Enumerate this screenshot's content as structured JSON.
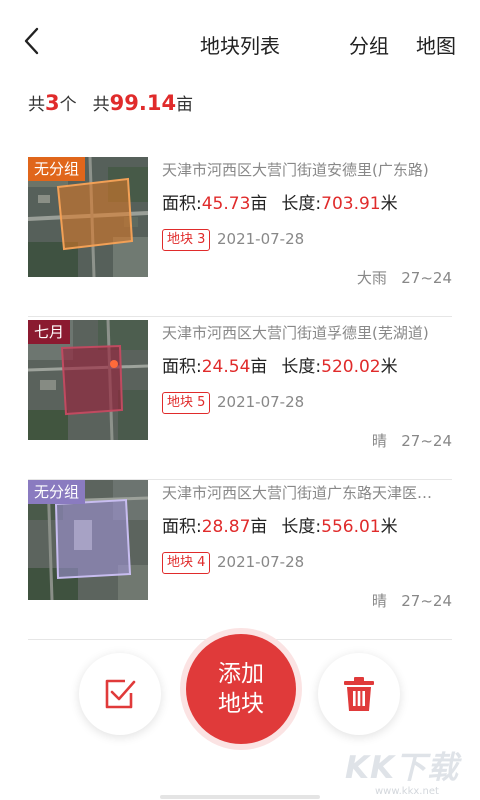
{
  "header": {
    "title": "地块列表",
    "group_label": "分组",
    "map_label": "地图"
  },
  "summary": {
    "prefix1": "共",
    "count": "3",
    "count_unit": "个",
    "prefix2": "共",
    "total_area": "99.14",
    "area_unit": "亩"
  },
  "labels": {
    "area": "面积:",
    "area_unit": "亩",
    "length": "长度:",
    "length_unit": "米"
  },
  "plots": [
    {
      "group_tag": "无分组",
      "tag_color": "#e0661b",
      "address": "天津市河西区大营门街道安德里(广东路)",
      "area": "45.73",
      "length": "703.91",
      "plot_label": "地块 3",
      "date": "2021-07-28",
      "weather": "大雨",
      "temp": "27~24",
      "overlay_color": "#e37a24"
    },
    {
      "group_tag": "七月",
      "tag_color": "#8b1a30",
      "address": "天津市河西区大营门街道孚德里(芜湖道)",
      "area": "24.54",
      "length": "520.02",
      "plot_label": "地块 5",
      "date": "2021-07-28",
      "weather": "晴",
      "temp": "27~24",
      "overlay_color": "#9b1f3a"
    },
    {
      "group_tag": "无分组",
      "tag_color": "#8a7bc0",
      "address": "天津市河西区大营门街道广东路天津医…",
      "area": "28.87",
      "length": "556.01",
      "plot_label": "地块 4",
      "date": "2021-07-28",
      "weather": "晴",
      "temp": "27~24",
      "overlay_color": "#a597e0"
    }
  ],
  "actions": {
    "add_line1": "添加",
    "add_line2": "地块",
    "select_icon": "checkbox-icon",
    "delete_icon": "trash-icon"
  },
  "watermark": {
    "logo": "KK下载",
    "url": "www.kkx.net"
  },
  "colors": {
    "accent": "#e03a3a",
    "number_red": "#e02b2b"
  }
}
